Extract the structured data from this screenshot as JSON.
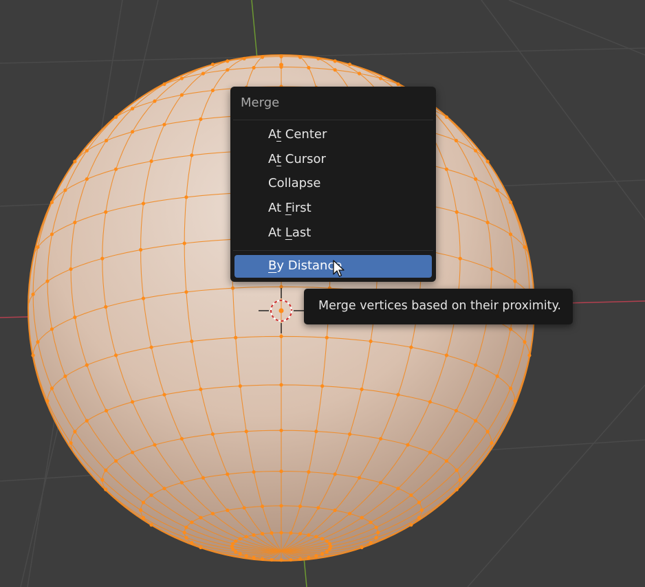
{
  "viewport": {
    "background_color": "#3d3d3d",
    "grid_line_color": "#4a4a4a",
    "x_axis_color": "#b3404f",
    "y_axis_color": "#6d9a32",
    "mesh_face_color": "#d9c0ae",
    "mesh_edge_color": "#f08a24",
    "mesh_vertex_color": "#ff8c1a",
    "object_name": "UV Sphere",
    "selection_mode": "all vertices selected"
  },
  "merge_menu": {
    "title": "Merge",
    "items": [
      {
        "label": "At Center",
        "mnemonic": "t",
        "active": false
      },
      {
        "label": "At Cursor",
        "mnemonic": "t",
        "active": false
      },
      {
        "label": "Collapse",
        "mnemonic": "",
        "active": false
      },
      {
        "label": "At First",
        "mnemonic": "F",
        "active": false
      },
      {
        "label": "At Last",
        "mnemonic": "L",
        "active": false
      },
      {
        "label": "By Distance",
        "mnemonic": "B",
        "active": true
      }
    ],
    "active_color": "#4772b3"
  },
  "tooltip": {
    "text": "Merge vertices based on their proximity."
  },
  "icons": {
    "cursor": "mouse-pointer-icon",
    "origin": "3d-cursor-icon"
  }
}
